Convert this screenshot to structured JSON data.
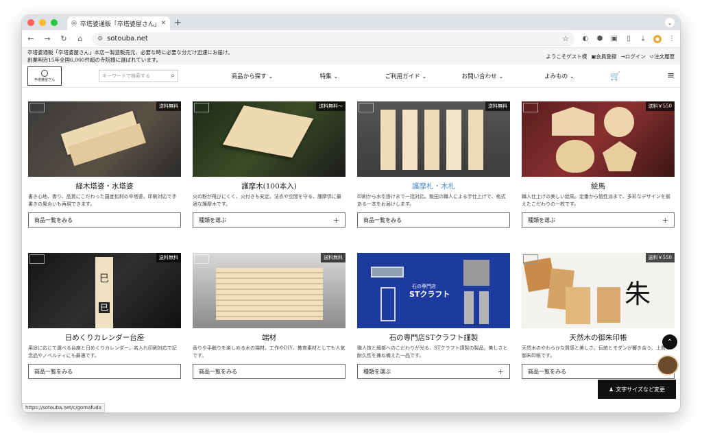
{
  "browser": {
    "tab_title": "卒塔婆通販「卒塔婆屋さん」製造",
    "url": "sotouba.net",
    "status_url": "https://sotouba.net/c/gomafuda"
  },
  "site": {
    "tagline_1": "卒塔婆通販「卒塔婆屋さん」本店ー製造販売元、必要な時に必要な分だけ迅速にお届け。",
    "tagline_2": "創業明治15年全国6,000件超の寺院様に選ばれています。",
    "welcome": "ようこそゲスト様",
    "register": "会員登録",
    "login": "ログイン",
    "history": "注文履歴",
    "logo_text": "卒塔婆屋さん",
    "search_placeholder": "キーワードで検索する",
    "nav": [
      "商品から探す",
      "特集",
      "ご利用ガイド",
      "お問い合わせ",
      "よみもの"
    ],
    "font_size_button": "文字サイズなど変更"
  },
  "cards": [
    {
      "title": "経木塔婆・水塔婆",
      "desc": "書き心地、香り、品質にこだわった国産松材の卒塔婆。印刷対応で手書きの風合いも再現できます。",
      "button": "商品一覧をみる",
      "badge": "送料無料",
      "plus": "",
      "highlight": false
    },
    {
      "title": "護摩木(100本入)",
      "desc": "火の粉が飛びにくく、火付きも安定。法衣や空間を守る、護摩供に最適な護摩木です。",
      "button": "種類を選ぶ",
      "badge": "送料無料〜",
      "plus": "+",
      "highlight": false
    },
    {
      "title": "護摩札・木札",
      "desc": "印刷から水引掛けまで一括対応。飯田の職人による手仕上げで、格式ある一本をお届けします。",
      "button": "商品一覧をみる",
      "badge": "送料無料",
      "plus": "",
      "highlight": true
    },
    {
      "title": "絵馬",
      "desc": "職人仕上げの美しい絵馬。定番から個性派まで、多彩なデザインを揃えたこだわりの一枚です。",
      "button": "種類を選ぶ",
      "badge": "送料￥550",
      "plus": "+",
      "highlight": false
    },
    {
      "title": "日めくりカレンダー台座",
      "desc": "用途に応じて選べる台座と日めくりカレンダー。名入れ印刷対応で記念品やノベルティにも最適です。",
      "button": "商品一覧をみる",
      "badge": "送料無料",
      "plus": "",
      "highlight": false
    },
    {
      "title": "端材",
      "desc": "香りや手触りを楽しめる木の端材。工作やDIY、教育素材としても人気です。",
      "button": "商品一覧をみる",
      "badge": "送料無料",
      "plus": "",
      "highlight": false
    },
    {
      "title": "石の専門店STクラフト謹製",
      "desc": "職人技と細部へのこだわりが光る、STクラフト謹製の製品。美しさと耐久性を兼ね備えた一品です。",
      "button": "種類を選ぶ",
      "badge": "",
      "plus": "+",
      "highlight": false
    },
    {
      "title": "天然木の御朱印帳",
      "desc": "天然木のやわらかな質感と美しさ。伝統とモダンが響き合う、上質な御朱印帳です。",
      "button": "商品一覧をみる",
      "badge": "送料￥550",
      "plus": "",
      "highlight": false
    }
  ],
  "images": {
    "card_3_caption": "石の専門店",
    "card_3_brand": "STクラフト"
  },
  "colors": {
    "accent_link": "#4a8cc7",
    "dark": "#111111"
  }
}
